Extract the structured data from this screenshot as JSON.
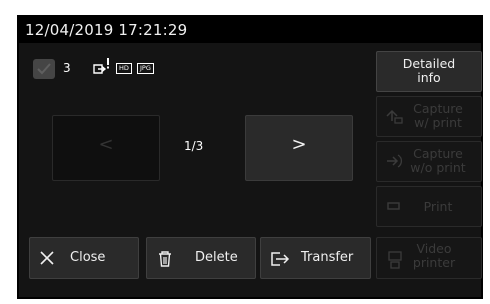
{
  "header": {
    "datetime": "12/04/2019 17:21:29"
  },
  "status": {
    "selected_count": "3",
    "badges": [
      "HD",
      "JPG"
    ],
    "icons": [
      "checkbox-checked-icon",
      "transfer-alert-icon"
    ]
  },
  "navigation": {
    "prev_symbol": "<",
    "next_symbol": ">",
    "page_indicator": "1/3"
  },
  "side_buttons": {
    "detailed_info": {
      "line1": "Detailed",
      "line2": "info"
    },
    "capture_print": {
      "line1": "Capture",
      "line2": "w/ print"
    },
    "capture_no_print": {
      "line1": "Capture",
      "line2": "w/o print"
    },
    "print": {
      "label": "Print"
    }
  },
  "bottom_buttons": {
    "close": "Close",
    "delete": "Delete",
    "transfer": "Transfer",
    "video_printer": {
      "line1": "Video",
      "line2": "printer"
    }
  },
  "colors": {
    "background": "#141414",
    "active_button": "#2a2a2a",
    "disabled_text": "#3b3b3b",
    "text": "#f0f0f0"
  }
}
